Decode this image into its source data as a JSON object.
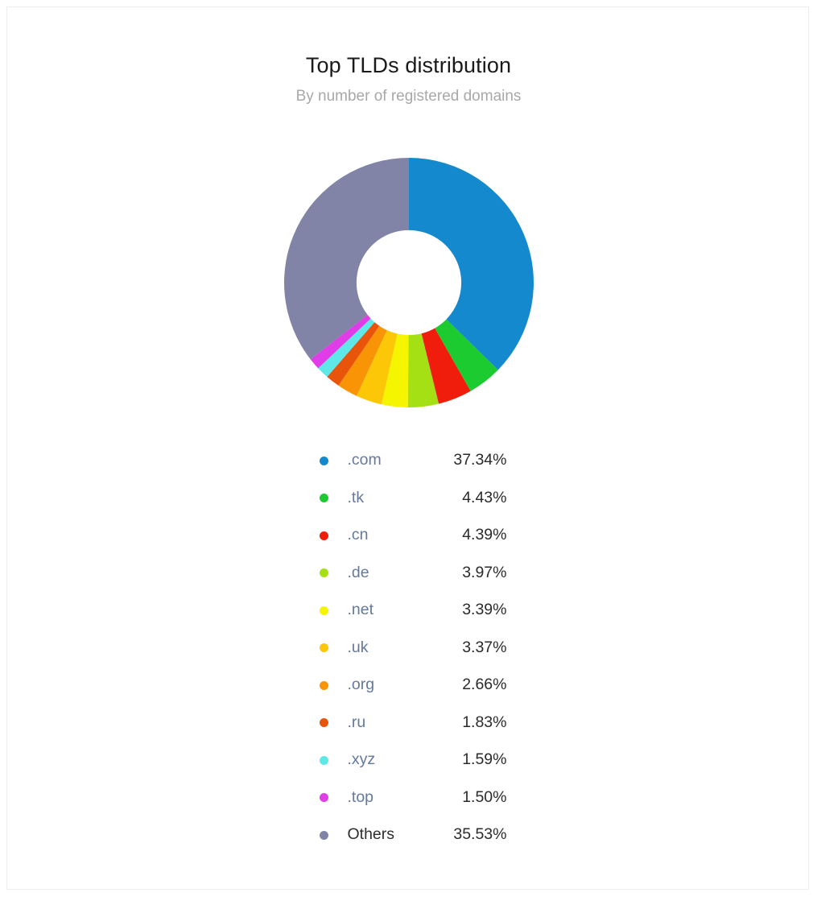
{
  "chart_data": {
    "type": "pie",
    "variant": "donut",
    "title": "Top TLDs distribution",
    "subtitle": "By number of registered domains",
    "xlabel": "",
    "ylabel": "",
    "legend_position": "bottom",
    "grid": false,
    "start_angle_deg": 0,
    "direction": "clockwise",
    "inner_radius_ratio": 0.42,
    "categories": [
      ".com",
      ".tk",
      ".cn",
      ".de",
      ".net",
      ".uk",
      ".org",
      ".ru",
      ".xyz",
      ".top",
      "Others"
    ],
    "values": [
      37.34,
      4.43,
      4.39,
      3.97,
      3.39,
      3.37,
      2.66,
      1.83,
      1.59,
      1.5,
      35.53
    ],
    "value_labels": [
      "37.34%",
      "4.43%",
      "4.39%",
      "3.97%",
      "3.39%",
      "3.37%",
      "2.66%",
      "1.83%",
      "1.59%",
      "1.50%",
      "35.53%"
    ],
    "unit": "%",
    "colors": [
      "#1589ce",
      "#1ccb2f",
      "#f01c0c",
      "#a5e014",
      "#f5f500",
      "#fbc707",
      "#f89406",
      "#e8540a",
      "#5ee8e8",
      "#e03ce8",
      "#8184a6"
    ],
    "slices": [
      {
        "label": ".com",
        "value": 37.34,
        "value_label": "37.34%",
        "color": "#1589ce",
        "is_link": true
      },
      {
        "label": ".tk",
        "value": 4.43,
        "value_label": "4.43%",
        "color": "#1ccb2f",
        "is_link": true
      },
      {
        "label": ".cn",
        "value": 4.39,
        "value_label": "4.39%",
        "color": "#f01c0c",
        "is_link": true
      },
      {
        "label": ".de",
        "value": 3.97,
        "value_label": "3.97%",
        "color": "#a5e014",
        "is_link": true
      },
      {
        "label": ".net",
        "value": 3.39,
        "value_label": "3.39%",
        "color": "#f5f500",
        "is_link": true
      },
      {
        "label": ".uk",
        "value": 3.37,
        "value_label": "3.37%",
        "color": "#fbc707",
        "is_link": true
      },
      {
        "label": ".org",
        "value": 2.66,
        "value_label": "2.66%",
        "color": "#f89406",
        "is_link": true
      },
      {
        "label": ".ru",
        "value": 1.83,
        "value_label": "1.83%",
        "color": "#e8540a",
        "is_link": true
      },
      {
        "label": ".xyz",
        "value": 1.59,
        "value_label": "1.59%",
        "color": "#5ee8e8",
        "is_link": true
      },
      {
        "label": ".top",
        "value": 1.5,
        "value_label": "1.50%",
        "color": "#e03ce8",
        "is_link": true
      },
      {
        "label": "Others",
        "value": 35.53,
        "value_label": "35.53%",
        "color": "#8184a6",
        "is_link": false
      }
    ]
  },
  "chart": {
    "title": "Top TLDs distribution",
    "subtitle": "By number of registered domains"
  }
}
